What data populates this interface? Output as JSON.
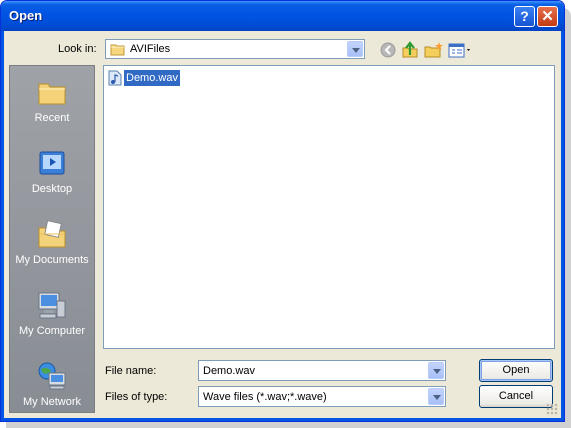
{
  "window": {
    "title": "Open",
    "help_label": "?",
    "close_label": "✕"
  },
  "look_in": {
    "label": "Look in:",
    "value": "AVIFiles"
  },
  "toolbar": {
    "icons": [
      "back-icon",
      "up-folder-icon",
      "new-folder-icon",
      "views-menu-icon"
    ]
  },
  "places": [
    {
      "label": "Recent",
      "icon": "recent-folder-icon"
    },
    {
      "label": "Desktop",
      "icon": "desktop-icon"
    },
    {
      "label": "My Documents",
      "icon": "my-documents-icon"
    },
    {
      "label": "My Computer",
      "icon": "my-computer-icon"
    },
    {
      "label": "My Network",
      "icon": "my-network-icon"
    }
  ],
  "files": [
    {
      "name": "Demo.wav",
      "icon": "audio-file-icon",
      "selected": true
    }
  ],
  "file_name": {
    "label": "File name:",
    "value": "Demo.wav"
  },
  "file_type": {
    "label": "Files of type:",
    "value": "Wave files (*.wav;*.wave)"
  },
  "buttons": {
    "open": "Open",
    "cancel": "Cancel"
  },
  "colors": {
    "titlebar": "#0054e3",
    "selection": "#316ac5",
    "dialog_bg": "#ece9d8",
    "places_bg": "#8b8f95"
  }
}
